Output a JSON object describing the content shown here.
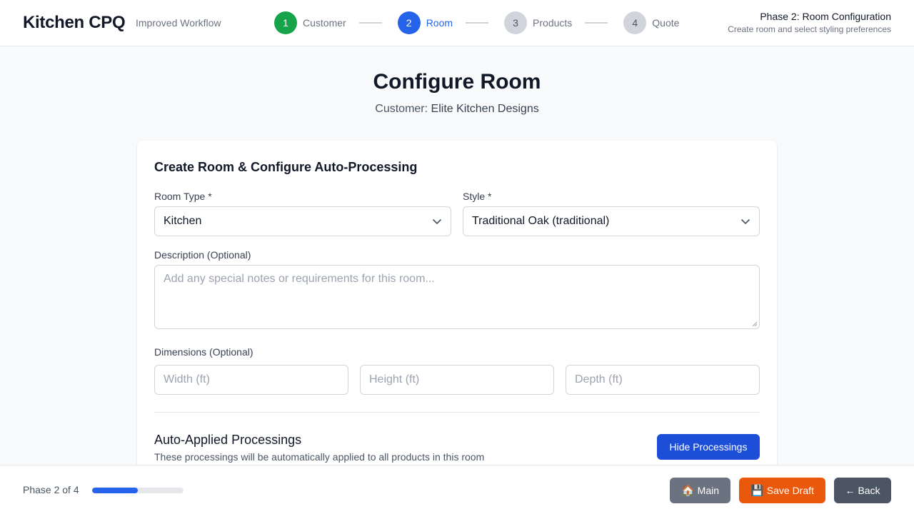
{
  "header": {
    "app_title": "Kitchen CPQ",
    "subtitle": "Improved Workflow",
    "steps": [
      {
        "number": "1",
        "label": "Customer",
        "state": "done"
      },
      {
        "number": "2",
        "label": "Room",
        "state": "active"
      },
      {
        "number": "3",
        "label": "Products",
        "state": "todo"
      },
      {
        "number": "4",
        "label": "Quote",
        "state": "todo"
      }
    ],
    "phase_title": "Phase 2: Room Configuration",
    "phase_desc": "Create room and select styling preferences"
  },
  "main": {
    "title": "Configure Room",
    "customer_label": "Customer:",
    "customer_name": "Elite Kitchen Designs"
  },
  "form": {
    "card_title": "Create Room & Configure Auto-Processing",
    "room_type_label": "Room Type *",
    "room_type_value": "Kitchen",
    "style_label": "Style *",
    "style_value": "Traditional Oak (traditional)",
    "description_label": "Description (Optional)",
    "description_placeholder": "Add any special notes or requirements for this room...",
    "dimensions_label": "Dimensions (Optional)",
    "width_placeholder": "Width (ft)",
    "height_placeholder": "Height (ft)",
    "depth_placeholder": "Depth (ft)"
  },
  "processings": {
    "title": "Auto-Applied Processings",
    "description": "These processings will be automatically applied to all products in this room",
    "hide_button": "Hide Processings"
  },
  "footer": {
    "phase_count": "Phase 2 of 4",
    "progress_fraction": 0.5,
    "main_icon": "🏠",
    "main_label": "Main",
    "save_icon": "💾",
    "save_label": "Save Draft",
    "back_icon": "←",
    "back_label": "Back"
  },
  "colors": {
    "primary": "#2563eb",
    "success": "#16a34a",
    "save": "#ea580c",
    "neutral": "#6b7280",
    "dark": "#4b5563"
  }
}
